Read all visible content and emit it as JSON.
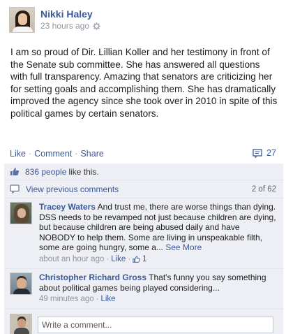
{
  "post": {
    "author": "Nikki Haley",
    "timestamp": "23 hours ago",
    "body": "I am so proud of Dir. Lillian Koller and her testimony in front of the Senate sub committee. She has answered all questions with full transparency. Amazing that senators are criticizing her for setting goals and accomplishing them. She has dramatically improved the agency since she took over in 2010 in spite of this political games by certain senators."
  },
  "actions": {
    "like": "Like",
    "comment": "Comment",
    "share": "Share",
    "separator": "·",
    "comment_count": "27"
  },
  "likes": {
    "count_link": "836 people",
    "suffix": "like this."
  },
  "previous": {
    "link": "View previous comments",
    "pager": "2 of 62"
  },
  "comments": [
    {
      "name": "Tracey Waters",
      "text": "And trust me, there are worse things than dying. DSS needs to be revamped not just because children are dying, but because children are being abused daily and have NOBODY to help them. Some are living in unspeakable filth, some are going hungry, some a...",
      "see_more": "See More",
      "time": "about an hour ago",
      "like": "Like",
      "like_count": "1"
    },
    {
      "name": "Christopher Richard Gross",
      "text": "That's funny you say something about political games being played considering...",
      "time": "49 minutes ago",
      "like": "Like"
    }
  ],
  "composer": {
    "placeholder": "Write a comment..."
  },
  "colors": {
    "link": "#3b5998",
    "panel": "#edeff4",
    "meta": "#90949c"
  }
}
